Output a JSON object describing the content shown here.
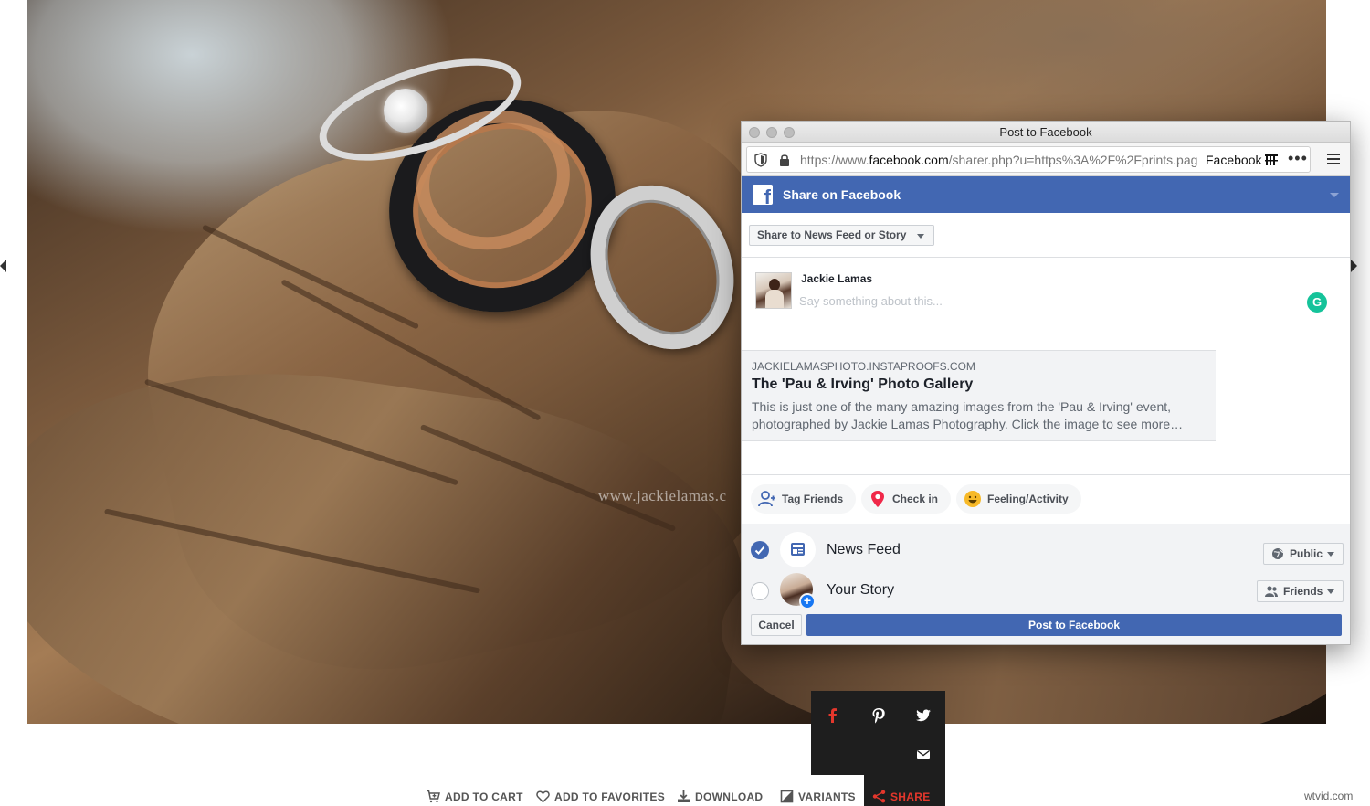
{
  "photo": {
    "watermark": "www.jackielamas.c"
  },
  "popup": {
    "window_title": "Post to Facebook",
    "url": {
      "prefix": "https://www.",
      "domain": "facebook.com",
      "path": "/sharer.php?u=https%3A%2F%2Fprints.pag",
      "reader_label": "Facebook",
      "more": "•••"
    },
    "header": {
      "logo": "f",
      "title": "Share on Facebook"
    },
    "share_target": "Share to News Feed or Story",
    "composer": {
      "user_name": "Jackie Lamas",
      "placeholder": "Say something about this...",
      "grammarly": "G"
    },
    "link_card": {
      "domain": "JACKIELAMASPHOTO.INSTAPROOFS.COM",
      "title": "The 'Pau & Irving' Photo Gallery",
      "description": "This is just one of the many amazing images from the 'Pau & Irving' event, photographed by Jackie Lamas Photography. Click the image to see more…"
    },
    "actions": {
      "tag_friends": "Tag Friends",
      "check_in": "Check in",
      "feeling": "Feeling/Activity"
    },
    "audience": {
      "news_feed": {
        "label": "News Feed",
        "checked": true,
        "privacy": "Public"
      },
      "your_story": {
        "label": "Your Story",
        "checked": false,
        "privacy": "Friends"
      }
    },
    "buttons": {
      "cancel": "Cancel",
      "post": "Post to Facebook"
    },
    "colors": {
      "facebook_blue": "#4267b2",
      "grammarly_green": "#15c39a"
    }
  },
  "share_menu": {
    "icons": [
      "facebook-icon",
      "pinterest-icon",
      "twitter-icon",
      "email-icon"
    ],
    "active_color": "#e4372c"
  },
  "toolbar": {
    "add_to_cart": "ADD TO CART",
    "add_to_favorites": "ADD TO FAVORITES",
    "download": "DOWNLOAD",
    "variants": "VARIANTS",
    "share": "SHARE"
  },
  "site_mark": "wtvid.com"
}
